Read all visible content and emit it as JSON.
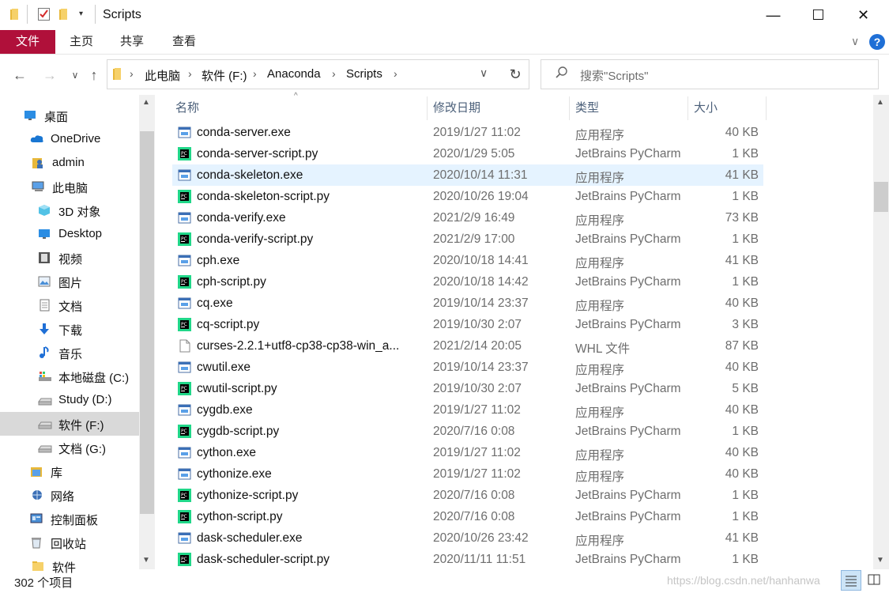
{
  "window": {
    "title": "Scripts",
    "minimize_glyph": "—",
    "maximize_glyph": "☐",
    "close_glyph": "✕"
  },
  "ribbon": {
    "tabs": [
      "文件",
      "主页",
      "共享",
      "查看"
    ],
    "help_icon": "question-mark-icon",
    "accent_color": "#b0103a",
    "help_color": "#1f6fd6"
  },
  "address": {
    "crumbs": [
      "此电脑",
      "软件 (F:)",
      "Anaconda",
      "Scripts"
    ],
    "search_placeholder": "搜索\"Scripts\""
  },
  "nav": {
    "items": [
      {
        "label": "桌面",
        "icon": "desktop-icon"
      },
      {
        "label": "OneDrive",
        "icon": "cloud-icon"
      },
      {
        "label": "admin",
        "icon": "user-folder-icon"
      },
      {
        "label": "此电脑",
        "icon": "computer-icon"
      },
      {
        "label": "3D 对象",
        "icon": "cube-icon"
      },
      {
        "label": "Desktop",
        "icon": "desktop-icon"
      },
      {
        "label": "视频",
        "icon": "video-icon"
      },
      {
        "label": "图片",
        "icon": "picture-icon"
      },
      {
        "label": "文档",
        "icon": "document-icon"
      },
      {
        "label": "下载",
        "icon": "download-icon"
      },
      {
        "label": "音乐",
        "icon": "music-icon"
      },
      {
        "label": "本地磁盘 (C:)",
        "icon": "system-drive-icon"
      },
      {
        "label": "Study (D:)",
        "icon": "drive-icon"
      },
      {
        "label": "软件 (F:)",
        "icon": "drive-icon",
        "selected": true
      },
      {
        "label": "文档 (G:)",
        "icon": "drive-icon"
      },
      {
        "label": "库",
        "icon": "library-icon"
      },
      {
        "label": "网络",
        "icon": "network-icon"
      },
      {
        "label": "控制面板",
        "icon": "control-panel-icon"
      },
      {
        "label": "回收站",
        "icon": "recycle-bin-icon"
      },
      {
        "label": "软件",
        "icon": "folder-icon"
      }
    ]
  },
  "columns": {
    "name": "名称",
    "date": "修改日期",
    "type": "类型",
    "size": "大小"
  },
  "files": [
    {
      "name": "conda-server.exe",
      "date": "2019/1/27 11:02",
      "type": "应用程序",
      "size": "40 KB",
      "kind": "exe"
    },
    {
      "name": "conda-server-script.py",
      "date": "2020/1/29 5:05",
      "type": "JetBrains PyCharm",
      "size": "1 KB",
      "kind": "py"
    },
    {
      "name": "conda-skeleton.exe",
      "date": "2020/10/14 11:31",
      "type": "应用程序",
      "size": "41 KB",
      "kind": "exe",
      "selected": true
    },
    {
      "name": "conda-skeleton-script.py",
      "date": "2020/10/26 19:04",
      "type": "JetBrains PyCharm",
      "size": "1 KB",
      "kind": "py"
    },
    {
      "name": "conda-verify.exe",
      "date": "2021/2/9 16:49",
      "type": "应用程序",
      "size": "73 KB",
      "kind": "exe"
    },
    {
      "name": "conda-verify-script.py",
      "date": "2021/2/9 17:00",
      "type": "JetBrains PyCharm",
      "size": "1 KB",
      "kind": "py"
    },
    {
      "name": "cph.exe",
      "date": "2020/10/18 14:41",
      "type": "应用程序",
      "size": "41 KB",
      "kind": "exe"
    },
    {
      "name": "cph-script.py",
      "date": "2020/10/18 14:42",
      "type": "JetBrains PyCharm",
      "size": "1 KB",
      "kind": "py"
    },
    {
      "name": "cq.exe",
      "date": "2019/10/14 23:37",
      "type": "应用程序",
      "size": "40 KB",
      "kind": "exe"
    },
    {
      "name": "cq-script.py",
      "date": "2019/10/30 2:07",
      "type": "JetBrains PyCharm",
      "size": "3 KB",
      "kind": "py"
    },
    {
      "name": "curses-2.2.1+utf8-cp38-cp38-win_a...",
      "date": "2021/2/14 20:05",
      "type": "WHL 文件",
      "size": "87 KB",
      "kind": "file"
    },
    {
      "name": "cwutil.exe",
      "date": "2019/10/14 23:37",
      "type": "应用程序",
      "size": "40 KB",
      "kind": "exe"
    },
    {
      "name": "cwutil-script.py",
      "date": "2019/10/30 2:07",
      "type": "JetBrains PyCharm",
      "size": "5 KB",
      "kind": "py"
    },
    {
      "name": "cygdb.exe",
      "date": "2019/1/27 11:02",
      "type": "应用程序",
      "size": "40 KB",
      "kind": "exe"
    },
    {
      "name": "cygdb-script.py",
      "date": "2020/7/16 0:08",
      "type": "JetBrains PyCharm",
      "size": "1 KB",
      "kind": "py"
    },
    {
      "name": "cython.exe",
      "date": "2019/1/27 11:02",
      "type": "应用程序",
      "size": "40 KB",
      "kind": "exe"
    },
    {
      "name": "cythonize.exe",
      "date": "2019/1/27 11:02",
      "type": "应用程序",
      "size": "40 KB",
      "kind": "exe"
    },
    {
      "name": "cythonize-script.py",
      "date": "2020/7/16 0:08",
      "type": "JetBrains PyCharm",
      "size": "1 KB",
      "kind": "py"
    },
    {
      "name": "cython-script.py",
      "date": "2020/7/16 0:08",
      "type": "JetBrains PyCharm",
      "size": "1 KB",
      "kind": "py"
    },
    {
      "name": "dask-scheduler.exe",
      "date": "2020/10/26 23:42",
      "type": "应用程序",
      "size": "41 KB",
      "kind": "exe"
    },
    {
      "name": "dask-scheduler-script.py",
      "date": "2020/11/11 11:51",
      "type": "JetBrains PyCharm",
      "size": "1 KB",
      "kind": "py"
    }
  ],
  "status": {
    "item_count": "302 个项目"
  },
  "watermark": "https://blog.csdn.net/hanhanwa"
}
